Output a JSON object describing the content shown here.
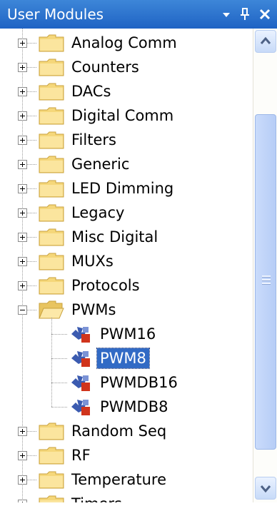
{
  "panel": {
    "title": "User Modules",
    "buttons": {
      "dropdown_icon": "triangle-down",
      "pin_icon": "pin",
      "close_icon": "close-x"
    }
  },
  "tree": {
    "items": [
      {
        "label": "Analog Comm",
        "type": "folder",
        "expanded": false
      },
      {
        "label": "Counters",
        "type": "folder",
        "expanded": false
      },
      {
        "label": "DACs",
        "type": "folder",
        "expanded": false
      },
      {
        "label": "Digital Comm",
        "type": "folder",
        "expanded": false
      },
      {
        "label": "Filters",
        "type": "folder",
        "expanded": false
      },
      {
        "label": "Generic",
        "type": "folder",
        "expanded": false
      },
      {
        "label": "LED Dimming",
        "type": "folder",
        "expanded": false
      },
      {
        "label": "Legacy",
        "type": "folder",
        "expanded": false
      },
      {
        "label": "Misc Digital",
        "type": "folder",
        "expanded": false
      },
      {
        "label": "MUXs",
        "type": "folder",
        "expanded": false
      },
      {
        "label": "Protocols",
        "type": "folder",
        "expanded": false
      },
      {
        "label": "PWMs",
        "type": "folder",
        "expanded": true,
        "children": [
          {
            "label": "PWM16",
            "selected": false
          },
          {
            "label": "PWM8",
            "selected": true
          },
          {
            "label": "PWMDB16",
            "selected": false
          },
          {
            "label": "PWMDB8",
            "selected": false
          }
        ]
      },
      {
        "label": "Random Seq",
        "type": "folder",
        "expanded": false
      },
      {
        "label": "RF",
        "type": "folder",
        "expanded": false
      },
      {
        "label": "Temperature",
        "type": "folder",
        "expanded": false
      },
      {
        "label": "Timers",
        "type": "folder",
        "expanded": false
      }
    ]
  },
  "colors": {
    "title_bar": "#2a6fd0",
    "selection": "#316ac5",
    "folder": "#f5d77a",
    "module_icon_blue": "#3b5bb0",
    "module_icon_red": "#d0341c"
  }
}
